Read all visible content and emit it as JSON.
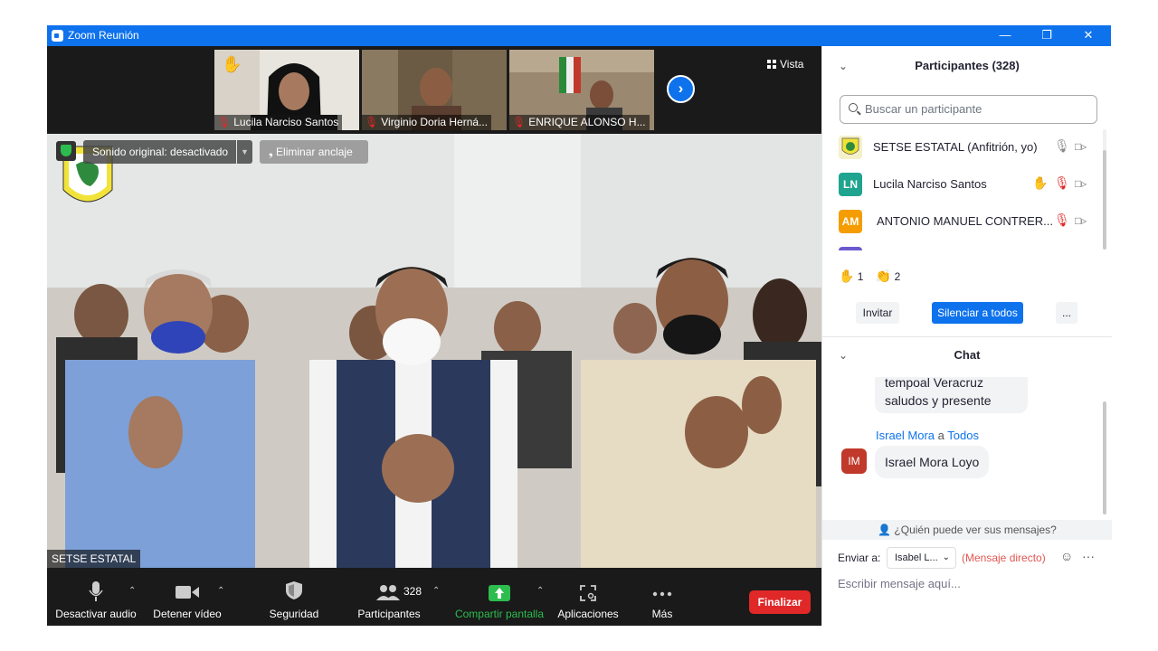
{
  "window": {
    "title": "Zoom Reunión"
  },
  "thumbnails": [
    {
      "name": "Lucila Narciso Santos"
    },
    {
      "name": "Virginio Doria Herná..."
    },
    {
      "name": "ENRIQUE ALONSO H..."
    }
  ],
  "view_label": "Vista",
  "main_video": {
    "audio_label": "Sonido original: desactivado",
    "unpin_label": "Eliminar anclaje",
    "speaker_name": "SETSE ESTATAL"
  },
  "toolbar": {
    "audio": "Desactivar audio",
    "video": "Detener vídeo",
    "security": "Seguridad",
    "participants": "Participantes",
    "participants_count": "328",
    "share": "Compartir pantalla",
    "apps": "Aplicaciones",
    "more": "Más",
    "end": "Finalizar"
  },
  "participants_panel": {
    "title": "Participantes (328)",
    "search_placeholder": "Buscar un participante",
    "list": [
      {
        "name": "SETSE ESTATAL (Anfitrión, yo)",
        "initials": "",
        "color": "#f5f0c8"
      },
      {
        "name": "Lucila Narciso Santos",
        "initials": "LN",
        "color": "#1ea48f"
      },
      {
        "name": "ANTONIO MANUEL CONTRER...",
        "initials": "AM",
        "color": "#f59d00"
      }
    ],
    "raised_count": "1",
    "clap_count": "2",
    "invite": "Invitar",
    "mute_all": "Silenciar a todos",
    "more": "..."
  },
  "chat": {
    "title": "Chat",
    "messages": [
      {
        "lines": [
          "tempoal Veracruz",
          "saludos y presente"
        ]
      },
      {
        "sender": "Israel Mora",
        "connector": "a",
        "recipient": "Todos",
        "initials": "IM",
        "avatar_color": "#c0392b",
        "text": "Israel Mora Loyo"
      }
    ],
    "who_can_see": "¿Quién puede ver sus mensajes?",
    "send_to_label": "Enviar a:",
    "send_to_value": "Isabel L...",
    "direct_label": "(Mensaje directo)",
    "placeholder": "Escribir mensaje aquí..."
  },
  "colors": {
    "zoom_blue": "#0e72ed",
    "end_red": "#e02828",
    "share_green": "#2dbd4e"
  }
}
